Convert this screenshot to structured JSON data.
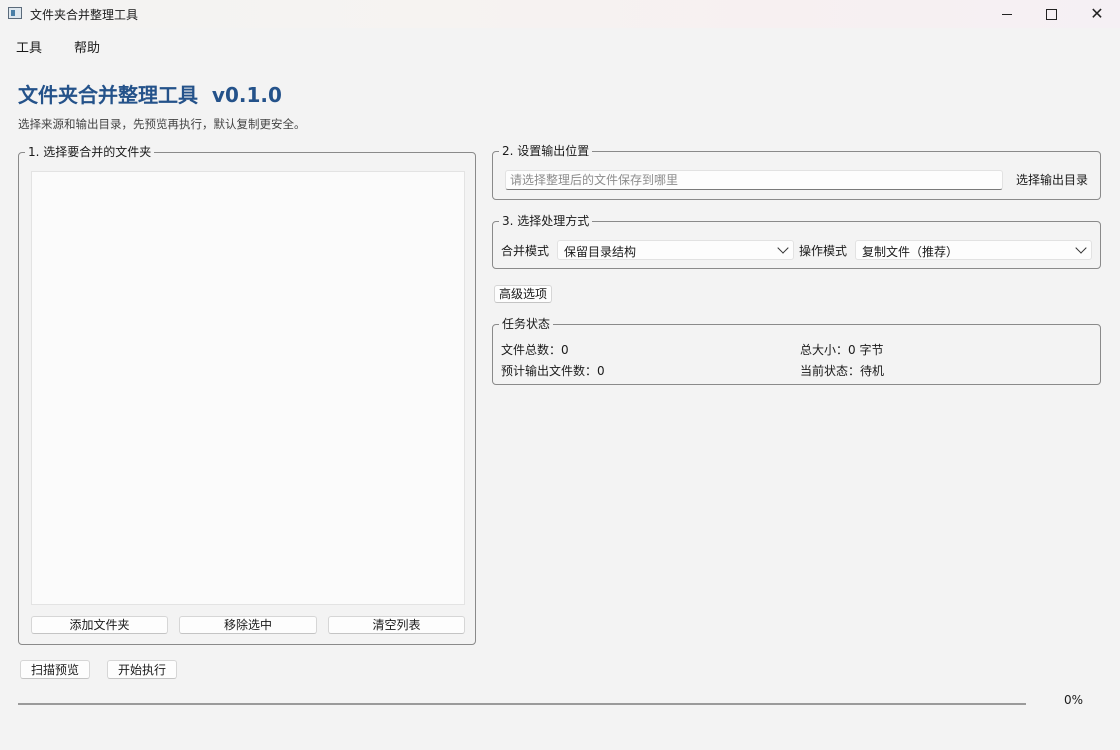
{
  "window": {
    "title": "文件夹合并整理工具"
  },
  "menu": {
    "tools": "工具",
    "help": "帮助"
  },
  "header": {
    "title": "文件夹合并整理工具  v0.1.0",
    "subtitle": "选择来源和输出目录，先预览再执行，默认复制更安全。"
  },
  "sources": {
    "group_title": "1. 选择要合并的文件夹",
    "add_button": "添加文件夹",
    "remove_button": "移除选中",
    "clear_button": "清空列表"
  },
  "output": {
    "group_title": "2. 设置输出位置",
    "placeholder": "请选择整理后的文件保存到哪里",
    "value": "",
    "choose_button": "选择输出目录"
  },
  "mode": {
    "group_title": "3. 选择处理方式",
    "merge_label": "合并模式",
    "merge_value": "保留目录结构",
    "op_label": "操作模式",
    "op_value": "复制文件（推荐）"
  },
  "advanced_button": "高级选项",
  "status": {
    "group_title": "任务状态",
    "total_files": "文件总数：0",
    "total_size": "总大小：0 字节",
    "expected_output": "预计输出文件数：0",
    "current_state": "当前状态：待机"
  },
  "actions": {
    "scan_preview": "扫描预览",
    "start": "开始执行"
  },
  "progress": {
    "value": 0,
    "text": "0%"
  },
  "colors": {
    "accent": "#24528a",
    "background": "#f3f3f3"
  }
}
